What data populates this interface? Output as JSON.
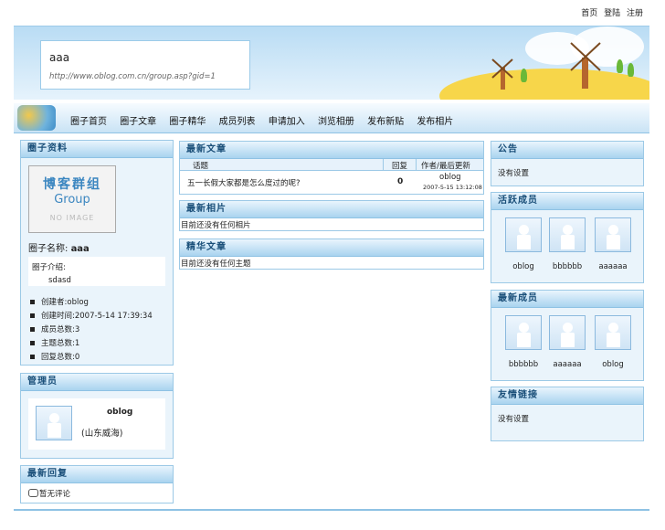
{
  "top_links": [
    "首页",
    "登陆",
    "注册"
  ],
  "header": {
    "title": "aaa",
    "url": "http://www.oblog.com.cn/group.asp?gid=1"
  },
  "nav": [
    "圈子首页",
    "圈子文章",
    "圈子精华",
    "成员列表",
    "申请加入",
    "浏览相册",
    "发布新贴",
    "发布相片"
  ],
  "group_info": {
    "title": "圈子资料",
    "logo_line1": "博客群组",
    "logo_line2": "Group",
    "logo_line3": "NO IMAGE",
    "name_label": "圈子名称:",
    "name_value": "aaa",
    "intro_label": "圈子介绍:",
    "intro_value": "sdasd",
    "stats": [
      "创建者:oblog",
      "创建时间:2007-5-14 17:39:34",
      "成员总数:3",
      "主题总数:1",
      "回复总数:0"
    ]
  },
  "admin": {
    "title": "管理员",
    "name": "oblog",
    "location": "(山东威海)"
  },
  "latest_replies": {
    "title": "最新回复",
    "empty": "暂无评论"
  },
  "latest_articles": {
    "title": "最新文章",
    "columns": [
      "话题",
      "回复",
      "作者/最后更新"
    ],
    "rows": [
      {
        "topic": "五一长假大家都是怎么度过的呢?",
        "replies": "0",
        "author": "oblog",
        "date": "2007-5-15 13:12:08"
      }
    ]
  },
  "latest_photos": {
    "title": "最新相片",
    "empty": "目前还没有任何相片"
  },
  "featured_articles": {
    "title": "精华文章",
    "empty": "目前还没有任何主题"
  },
  "announcement": {
    "title": "公告",
    "text": "没有设置"
  },
  "active_members": {
    "title": "活跃成员",
    "members": [
      "oblog",
      "bbbbbb",
      "aaaaaa"
    ]
  },
  "new_members": {
    "title": "最新成员",
    "members": [
      "bbbbbb",
      "aaaaaa",
      "oblog"
    ]
  },
  "friend_links": {
    "title": "友情链接",
    "text": "没有设置"
  }
}
